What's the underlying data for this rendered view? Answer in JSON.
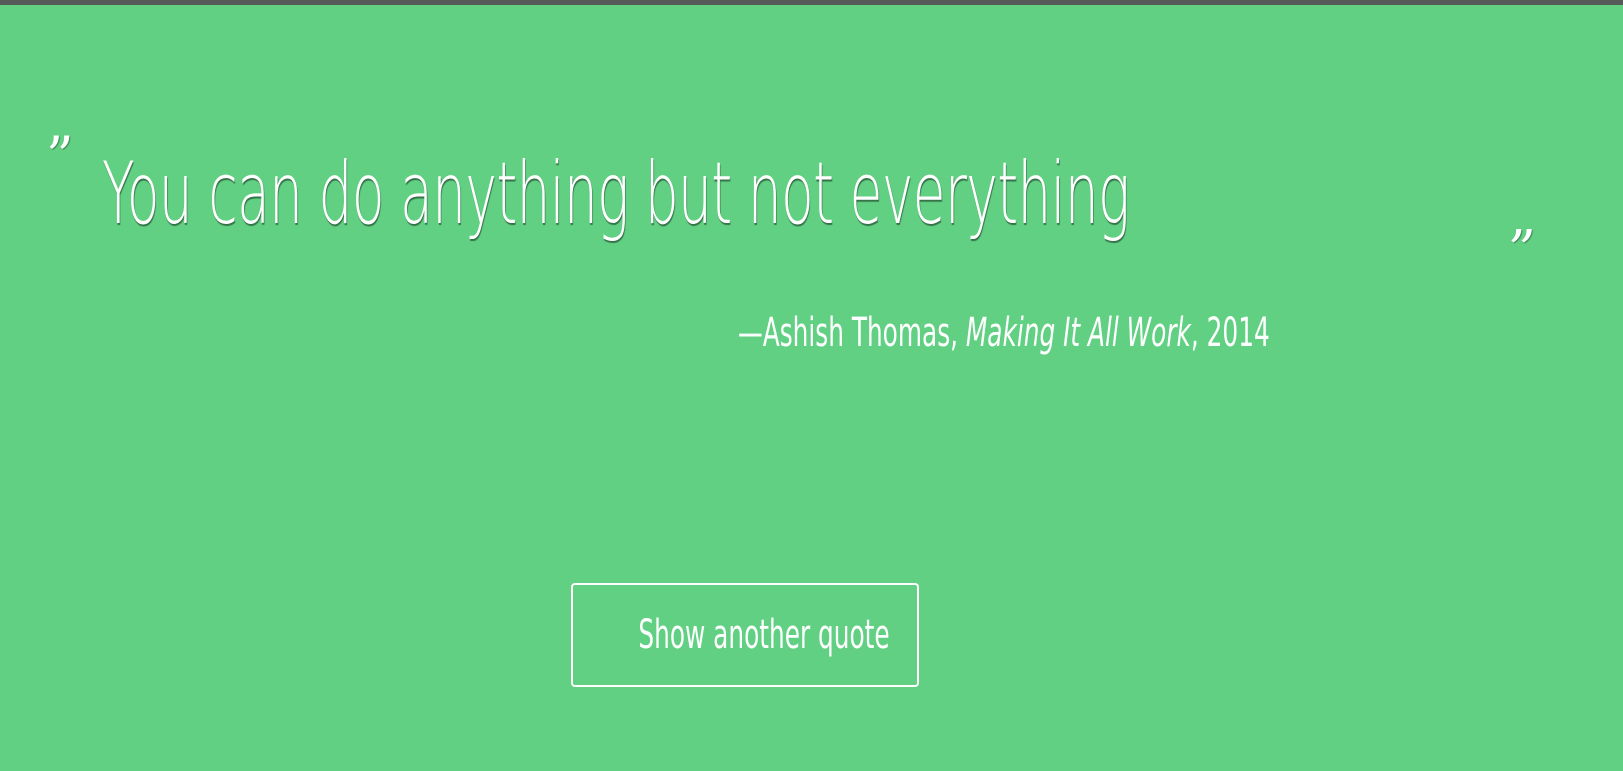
{
  "theme": {
    "background": "#61d083",
    "top_bar": "#555a58",
    "text": "#ffffff"
  },
  "quote": {
    "open_mark": "”",
    "text": "You can do anything but not everything",
    "close_mark": "„"
  },
  "attribution": {
    "prefix": "—Ashish Thomas, ",
    "work": "Making It All Work",
    "suffix": ", 2014"
  },
  "button": {
    "label": "Show another quote"
  }
}
